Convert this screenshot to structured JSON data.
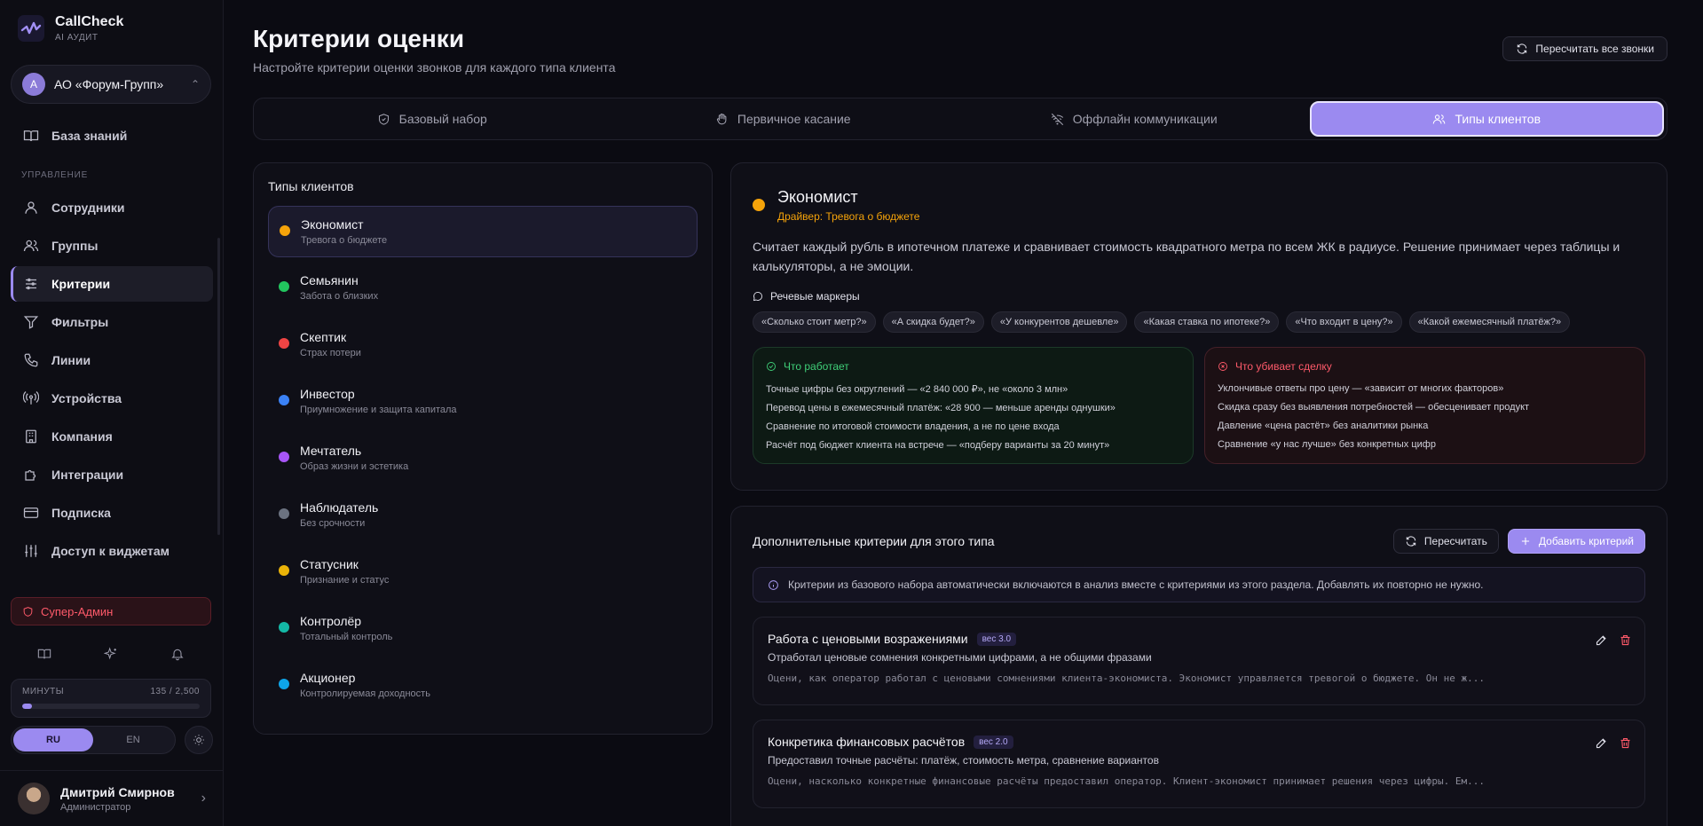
{
  "app": {
    "name": "CallCheck",
    "tagline": "AI АУДИТ"
  },
  "org": {
    "initial": "A",
    "name": "АО «Форум-Групп»"
  },
  "nav": {
    "knowledge": "База знаний",
    "section": "УПРАВЛЕНИЕ",
    "employees": "Сотрудники",
    "groups": "Группы",
    "criteria": "Критерии",
    "filters": "Фильтры",
    "lines": "Линии",
    "devices": "Устройства",
    "company": "Компания",
    "integrations": "Интеграции",
    "subscription": "Подписка",
    "widgets": "Доступ к виджетам"
  },
  "super_admin": "Супер-Админ",
  "minutes": {
    "label": "МИНУТЫ",
    "value": "135 / 2,500",
    "fraction": 0.054
  },
  "lang": {
    "ru": "RU",
    "en": "EN"
  },
  "user": {
    "name": "Дмитрий Смирнов",
    "role": "Администратор"
  },
  "page": {
    "title": "Критерии оценки",
    "subtitle": "Настройте критерии оценки звонков для каждого типа клиента",
    "recalc_all": "Пересчитать все звонки"
  },
  "tabs": [
    {
      "label": "Базовый набор",
      "icon": "shield-icon"
    },
    {
      "label": "Первичное касание",
      "icon": "hand-icon"
    },
    {
      "label": "Оффлайн коммуникации",
      "icon": "wifi-off-icon"
    },
    {
      "label": "Типы клиентов",
      "icon": "users-icon"
    }
  ],
  "types": {
    "title": "Типы клиентов",
    "items": [
      {
        "name": "Экономист",
        "driver": "Тревога о бюджете",
        "color": "#f5a30a"
      },
      {
        "name": "Семьянин",
        "driver": "Забота о близких",
        "color": "#22c55e"
      },
      {
        "name": "Скептик",
        "driver": "Страх потери",
        "color": "#ef4444"
      },
      {
        "name": "Инвестор",
        "driver": "Приумножение и защита капитала",
        "color": "#3b82f6"
      },
      {
        "name": "Мечтатель",
        "driver": "Образ жизни и эстетика",
        "color": "#a855f7"
      },
      {
        "name": "Наблюдатель",
        "driver": "Без срочности",
        "color": "#6b7280"
      },
      {
        "name": "Статусник",
        "driver": "Признание и статус",
        "color": "#eab308"
      },
      {
        "name": "Контролёр",
        "driver": "Тотальный контроль",
        "color": "#14b8a6"
      },
      {
        "name": "Акционер",
        "driver": "Контролируемая доходность",
        "color": "#0ea5e9"
      }
    ]
  },
  "detail": {
    "name": "Экономист",
    "driver": "Драйвер: Тревога о бюджете",
    "description": "Считает каждый рубль в ипотечном платеже и сравнивает стоимость квадратного метра по всем ЖК в радиусе. Решение принимает через таблицы и калькуляторы, а не эмоции.",
    "markers_title": "Речевые маркеры",
    "markers": [
      "«Сколько стоит метр?»",
      "«А скидка будет?»",
      "«У конкурентов дешевле»",
      "«Какая ставка по ипотеке?»",
      "«Что входит в цену?»",
      "«Какой ежемесячный платёж?»"
    ],
    "works_title": "Что работает",
    "works": [
      "Точные цифры без округлений — «2 840 000 ₽», не «около 3 млн»",
      "Перевод цены в ежемесячный платёж: «28 900 — меньше аренды однушки»",
      "Сравнение по итоговой стоимости владения, а не по цене входа",
      "Расчёт под бюджет клиента на встрече — «подберу варианты за 20 минут»"
    ],
    "kills_title": "Что убивает сделку",
    "kills": [
      "Уклончивые ответы про цену — «зависит от многих факторов»",
      "Скидка сразу без выявления потребностей — обесценивает продукт",
      "Давление «цена растёт» без аналитики рынка",
      "Сравнение «у нас лучше» без конкретных цифр"
    ]
  },
  "extra": {
    "title": "Дополнительные критерии для этого типа",
    "recalc": "Пересчитать",
    "add": "Добавить критерий",
    "note": "Критерии из базового набора автоматически включаются в анализ вместе с критериями из этого раздела. Добавлять их повторно не нужно.",
    "criteria": [
      {
        "title": "Работа с ценовыми возражениями",
        "weight": "вес 3.0",
        "desc": "Отработал ценовые сомнения конкретными цифрами, а не общими фразами",
        "prompt": "Оцени, как оператор работал с ценовыми сомнениями клиента-экономиста. Экономист управляется тревогой о бюджете. Он не ж..."
      },
      {
        "title": "Конкретика финансовых расчётов",
        "weight": "вес 2.0",
        "desc": "Предоставил точные расчёты: платёж, стоимость метра, сравнение вариантов",
        "prompt": "Оцени, насколько конкретные финансовые расчёты предоставил оператор. Клиент-экономист принимает решения через цифры. Ем..."
      }
    ]
  }
}
